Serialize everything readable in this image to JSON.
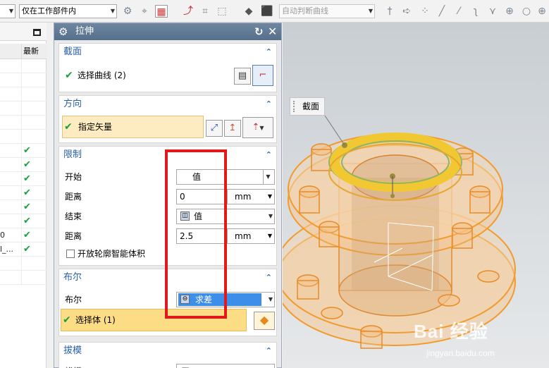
{
  "toolbar": {
    "scope_select": "仅在工作部件内",
    "curve_rule_select": "自动判断曲线",
    "icons": [
      "snap-view-icon",
      "wcs-icon",
      "filter-icon",
      "move-icon",
      "selection-icon",
      "box-select-icon",
      "solid-icon",
      "body-icon",
      "intersect-icon",
      "arrow-icon",
      "point-icon",
      "line-icon",
      "tangent-icon",
      "curve-icon",
      "branch-icon",
      "circle-icon",
      "ellipse-icon"
    ]
  },
  "navigator": {
    "column_header": "最新",
    "rows": [
      {
        "frag": "",
        "check": false
      },
      {
        "frag": "",
        "check": false
      },
      {
        "frag": "",
        "check": false
      },
      {
        "frag": "",
        "check": false
      },
      {
        "frag": "",
        "check": false
      },
      {
        "frag": "",
        "check": false
      },
      {
        "frag": "",
        "check": true
      },
      {
        "frag": "",
        "check": true
      },
      {
        "frag": "",
        "check": true
      },
      {
        "frag": "",
        "check": true
      },
      {
        "frag": "",
        "check": true
      },
      {
        "frag": "",
        "check": true
      },
      {
        "frag": "0",
        "check": true
      },
      {
        "frag": "l_...",
        "check": true
      },
      {
        "frag": "",
        "check": false
      },
      {
        "frag": "",
        "check": false
      }
    ]
  },
  "dialog": {
    "title": "拉伸",
    "section": {
      "title": "截面",
      "select_curve": "选择曲线 (2)"
    },
    "direction": {
      "title": "方向",
      "specify_vector": "指定矢量"
    },
    "limits": {
      "title": "限制",
      "start_label": "开始",
      "start_value": "值",
      "distance_label_1": "距离",
      "distance_value_1": "0",
      "unit_1": "mm",
      "end_label": "结束",
      "end_value": "值",
      "distance_label_2": "距离",
      "distance_value_2": "2.5",
      "unit_2": "mm",
      "open_profile": "开放轮廓智能体积"
    },
    "boolean": {
      "title": "布尔",
      "label": "布尔",
      "value": "求差",
      "select_body": "选择体 (1)"
    },
    "draft": {
      "title": "拔模",
      "label": "拔模",
      "value": "无"
    }
  },
  "viewport": {
    "tag": "截面",
    "watermark_brand": "Bai 经验",
    "watermark_url": "jingyan.baidu.com"
  },
  "colors": {
    "dialog_title": "#5f7893",
    "section_title": "#2a5fa8",
    "selection_fill": "#fddc86",
    "vector_fill": "#fdebc2",
    "check": "#19a03a",
    "highlight": "#e2191b",
    "boolean_fill": "#3d8ee8",
    "part_orange": "#f2a43a",
    "ring_yellow": "#f2c832"
  }
}
